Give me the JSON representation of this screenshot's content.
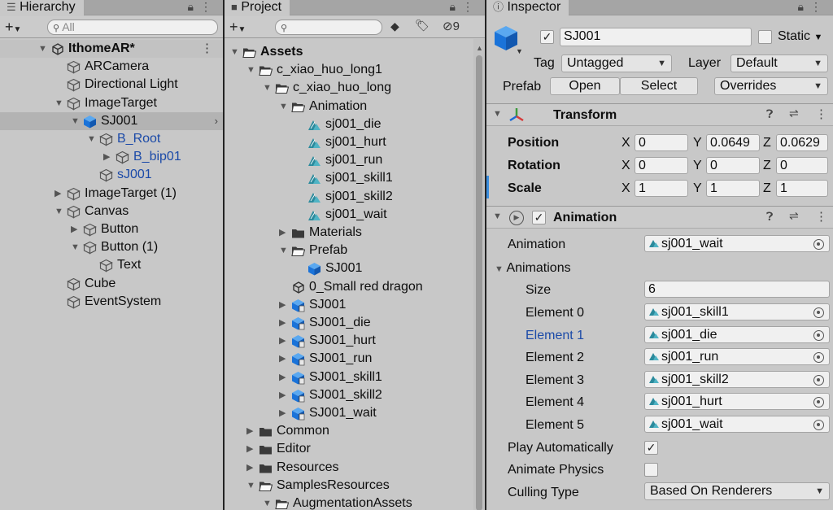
{
  "hierarchy": {
    "tab_title": "Hierarchy",
    "search_placeholder": "All",
    "rows": [
      {
        "label": "IthomeAR*",
        "level": 0,
        "arrow": "down",
        "icon": "unity-scene-icon"
      },
      {
        "label": "ARCamera",
        "level": 1,
        "arrow": "",
        "icon": "gameobject-icon"
      },
      {
        "label": "Directional Light",
        "level": 1,
        "arrow": "",
        "icon": "gameobject-icon"
      },
      {
        "label": "ImageTarget",
        "level": 1,
        "arrow": "down",
        "icon": "gameobject-icon"
      },
      {
        "label": "SJ001",
        "level": 2,
        "arrow": "down",
        "icon": "prefab-icon",
        "selected": true
      },
      {
        "label": "B_Root",
        "level": 3,
        "arrow": "down",
        "icon": "gameobject-icon",
        "blue": true
      },
      {
        "label": "B_bip01",
        "level": 4,
        "arrow": "right",
        "icon": "gameobject-icon",
        "blue": true
      },
      {
        "label": "sJ001",
        "level": 3,
        "arrow": "",
        "icon": "gameobject-icon",
        "blue": true
      },
      {
        "label": "ImageTarget (1)",
        "level": 1,
        "arrow": "right",
        "icon": "gameobject-icon"
      },
      {
        "label": "Canvas",
        "level": 1,
        "arrow": "down",
        "icon": "gameobject-icon"
      },
      {
        "label": "Button",
        "level": 2,
        "arrow": "right",
        "icon": "gameobject-icon"
      },
      {
        "label": "Button (1)",
        "level": 2,
        "arrow": "down",
        "icon": "gameobject-icon"
      },
      {
        "label": "Text",
        "level": 3,
        "arrow": "",
        "icon": "gameobject-icon"
      },
      {
        "label": "Cube",
        "level": 1,
        "arrow": "",
        "icon": "gameobject-icon"
      },
      {
        "label": "EventSystem",
        "level": 1,
        "arrow": "",
        "icon": "gameobject-icon"
      }
    ]
  },
  "project": {
    "tab_title": "Project",
    "hidden_count": "9",
    "rows": [
      {
        "label": "Assets",
        "level": 0,
        "arrow": "down",
        "icon": "folder-open-icon",
        "bold": true
      },
      {
        "label": "c_xiao_huo_long1",
        "level": 1,
        "arrow": "down",
        "icon": "folder-open-icon"
      },
      {
        "label": "c_xiao_huo_long",
        "level": 2,
        "arrow": "down",
        "icon": "folder-open-icon"
      },
      {
        "label": "Animation",
        "level": 3,
        "arrow": "down",
        "icon": "folder-open-icon"
      },
      {
        "label": "sj001_die",
        "level": 4,
        "arrow": "",
        "icon": "animation-clip-icon"
      },
      {
        "label": "sj001_hurt",
        "level": 4,
        "arrow": "",
        "icon": "animation-clip-icon"
      },
      {
        "label": "sj001_run",
        "level": 4,
        "arrow": "",
        "icon": "animation-clip-icon"
      },
      {
        "label": "sj001_skill1",
        "level": 4,
        "arrow": "",
        "icon": "animation-clip-icon"
      },
      {
        "label": "sj001_skill2",
        "level": 4,
        "arrow": "",
        "icon": "animation-clip-icon"
      },
      {
        "label": "sj001_wait",
        "level": 4,
        "arrow": "",
        "icon": "animation-clip-icon"
      },
      {
        "label": "Materials",
        "level": 3,
        "arrow": "right",
        "icon": "folder-icon"
      },
      {
        "label": "Prefab",
        "level": 3,
        "arrow": "down",
        "icon": "folder-open-icon"
      },
      {
        "label": "SJ001",
        "level": 4,
        "arrow": "",
        "icon": "prefab-icon"
      },
      {
        "label": "0_Small red dragon",
        "level": 3,
        "arrow": "",
        "icon": "unity-scene-icon"
      },
      {
        "label": "SJ001",
        "level": 3,
        "arrow": "right",
        "icon": "model-prefab-icon"
      },
      {
        "label": "SJ001_die",
        "level": 3,
        "arrow": "right",
        "icon": "model-prefab-icon"
      },
      {
        "label": "SJ001_hurt",
        "level": 3,
        "arrow": "right",
        "icon": "model-prefab-icon"
      },
      {
        "label": "SJ001_run",
        "level": 3,
        "arrow": "right",
        "icon": "model-prefab-icon"
      },
      {
        "label": "SJ001_skill1",
        "level": 3,
        "arrow": "right",
        "icon": "model-prefab-icon"
      },
      {
        "label": "SJ001_skill2",
        "level": 3,
        "arrow": "right",
        "icon": "model-prefab-icon"
      },
      {
        "label": "SJ001_wait",
        "level": 3,
        "arrow": "right",
        "icon": "model-prefab-icon"
      },
      {
        "label": "Common",
        "level": 1,
        "arrow": "right",
        "icon": "folder-icon"
      },
      {
        "label": "Editor",
        "level": 1,
        "arrow": "right",
        "icon": "folder-icon"
      },
      {
        "label": "Resources",
        "level": 1,
        "arrow": "right",
        "icon": "folder-icon"
      },
      {
        "label": "SamplesResources",
        "level": 1,
        "arrow": "down",
        "icon": "folder-open-icon"
      },
      {
        "label": "AugmentationAssets",
        "level": 2,
        "arrow": "down",
        "icon": "folder-open-icon"
      }
    ]
  },
  "inspector": {
    "tab_title": "Inspector",
    "object_name": "SJ001",
    "active_checked": true,
    "static_label": "Static",
    "tag_label": "Tag",
    "tag_value": "Untagged",
    "layer_label": "Layer",
    "layer_value": "Default",
    "prefab_label": "Prefab",
    "open_label": "Open",
    "select_label": "Select",
    "overrides_label": "Overrides",
    "transform": {
      "title": "Transform",
      "position_label": "Position",
      "rotation_label": "Rotation",
      "scale_label": "Scale",
      "x": "X",
      "y": "Y",
      "z": "Z",
      "position": [
        "0",
        "0.0649",
        "0.0629"
      ],
      "rotation": [
        "0",
        "0",
        "0"
      ],
      "scale": [
        "1",
        "1",
        "1"
      ]
    },
    "animation": {
      "title": "Animation",
      "animation_label": "Animation",
      "animation_value": "sj001_wait",
      "animations_label": "Animations",
      "size_label": "Size",
      "size_value": "6",
      "elements": [
        {
          "label": "Element 0",
          "value": "sj001_skill1"
        },
        {
          "label": "Element 1",
          "value": "sj001_die",
          "highlight": true
        },
        {
          "label": "Element 2",
          "value": "sj001_run"
        },
        {
          "label": "Element 3",
          "value": "sj001_skill2"
        },
        {
          "label": "Element 4",
          "value": "sj001_hurt"
        },
        {
          "label": "Element 5",
          "value": "sj001_wait"
        }
      ],
      "play_auto_label": "Play Automatically",
      "play_auto_checked": true,
      "animate_physics_label": "Animate Physics",
      "animate_physics_checked": false,
      "culling_label": "Culling Type",
      "culling_value": "Based On Renderers"
    }
  },
  "colors": {
    "panel_bg": "#c8c8c8",
    "selection": "#b3b3b3",
    "prefab_blue": "#1b4aa8",
    "cube_blue": "#1a73d9",
    "anim_teal": "#2b8a9c"
  }
}
